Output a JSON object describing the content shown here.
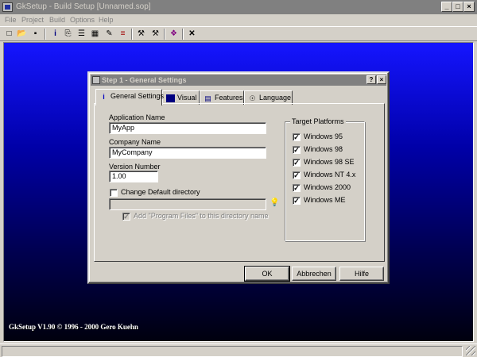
{
  "window": {
    "title": "GkSetup - Build Setup [Unnamed.sop]",
    "minimize": "_",
    "maximize": "□",
    "close": "×"
  },
  "menu": [
    "File",
    "Project",
    "Build",
    "Options",
    "Help"
  ],
  "toolbar": {
    "new": "□",
    "open": "📂",
    "save": "▪",
    "info": "i",
    "copy": "⎘",
    "list": "☰",
    "calendar": "▦",
    "edit": "✎",
    "compare": "≡",
    "build": "⚒",
    "rebuild": "⚒",
    "book": "❖",
    "exit": "✕"
  },
  "copyright": "GkSetup V1.90 © 1996 - 2000 Gero Kuehn",
  "dialog": {
    "title": "Step 1 - General Settings",
    "help": "?",
    "close": "×",
    "tabs": [
      {
        "label": "General Settings",
        "icon": "i"
      },
      {
        "label": "Visual",
        "icon": "▪"
      },
      {
        "label": "Features",
        "icon": "▤"
      },
      {
        "label": "Language",
        "icon": "☉"
      }
    ],
    "app_name_label": "Application Name",
    "app_name_value": "MyApp",
    "company_label": "Company Name",
    "company_value": "MyCompany",
    "version_label": "Version Number",
    "version_value": "1.00",
    "change_dir_label": "Change Default directory",
    "change_dir_checked": "",
    "directory_value": "",
    "add_program_files_label": "Add \"Program Files\" to this directory name",
    "add_program_files_check": "✓",
    "bulb": "💡",
    "platforms_title": "Target Platforms",
    "platforms": [
      {
        "label": "Windows 95",
        "check": "✓"
      },
      {
        "label": "Windows 98",
        "check": "✓"
      },
      {
        "label": "Windows 98 SE",
        "check": "✓"
      },
      {
        "label": "Windows NT 4.x",
        "check": "✓"
      },
      {
        "label": "Windows 2000",
        "check": "✓"
      },
      {
        "label": "Windows ME",
        "check": "✓"
      }
    ],
    "ok": "OK",
    "cancel": "Abbrechen",
    "help_button": "Hilfe"
  }
}
